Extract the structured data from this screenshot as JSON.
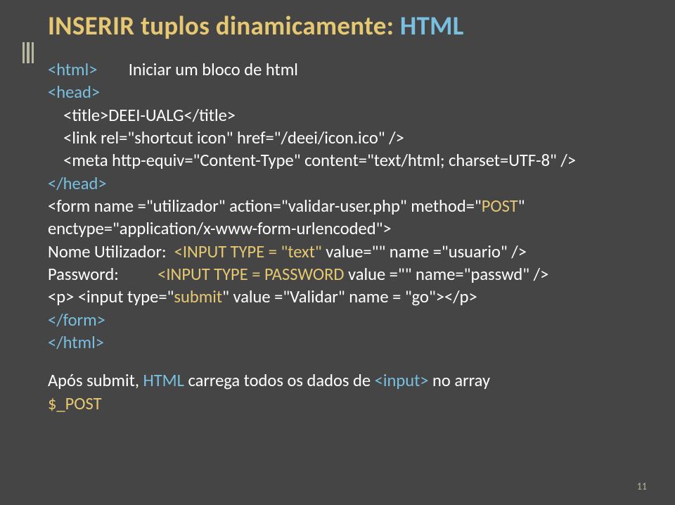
{
  "title": {
    "main": "INSERIR tuplos dinamicamente: ",
    "suffix": "HTML"
  },
  "code": {
    "l1a": "<html>",
    "l1b": "        Iniciar um bloco de html",
    "l2": "<head>",
    "l3": "    <title>DEEI-UALG</title>",
    "l4": "    <link rel=\"shortcut icon\" href=\"/deei/icon.ico\" />",
    "l5": "    <meta http-equiv=\"Content-Type\" content=\"text/html; charset=UTF-8\" />",
    "l6": "</head>",
    "l7a": "<form name =\"utilizador\" action=\"validar-user.php\" method=\"",
    "l7b": "POST",
    "l7c": "\"",
    "l8": "enctype=\"application/x-www-form-urlencoded\">",
    "l9a": "Nome Utilizador:  ",
    "l9b": "<INPUT TYPE = \"text\"",
    "l9c": " value=\"\" name =\"usuario\" />",
    "l10a": "Password:          ",
    "l10b": "<INPUT TYPE = PASSWORD",
    "l10c": " value =\"\" name=\"passwd\" />",
    "l11a": "<p> <input type=\"",
    "l11b": "submit",
    "l11c": "\" value =\"Validar\" name = \"go\"></p>",
    "l12": "</form>",
    "l13": "</html>"
  },
  "footer": {
    "a": "Após submit, ",
    "b": "HTML",
    "c": " carrega todos os dados de ",
    "d": "<input>",
    "e": " no array ",
    "f": "$_POST"
  },
  "page_number": "11"
}
